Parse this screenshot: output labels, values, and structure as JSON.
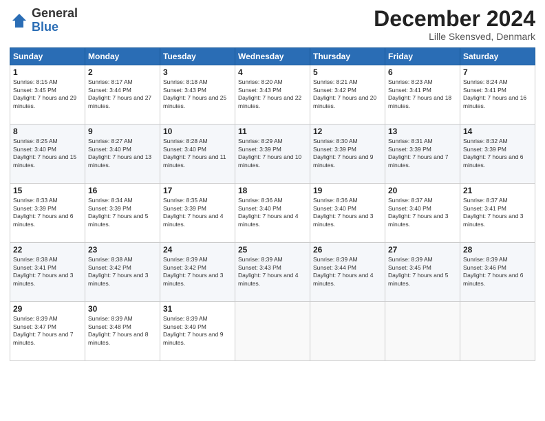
{
  "header": {
    "logo_general": "General",
    "logo_blue": "Blue",
    "month_title": "December 2024",
    "location": "Lille Skensved, Denmark"
  },
  "days_of_week": [
    "Sunday",
    "Monday",
    "Tuesday",
    "Wednesday",
    "Thursday",
    "Friday",
    "Saturday"
  ],
  "weeks": [
    [
      {
        "day": "1",
        "sunrise": "Sunrise: 8:15 AM",
        "sunset": "Sunset: 3:45 PM",
        "daylight": "Daylight: 7 hours and 29 minutes."
      },
      {
        "day": "2",
        "sunrise": "Sunrise: 8:17 AM",
        "sunset": "Sunset: 3:44 PM",
        "daylight": "Daylight: 7 hours and 27 minutes."
      },
      {
        "day": "3",
        "sunrise": "Sunrise: 8:18 AM",
        "sunset": "Sunset: 3:43 PM",
        "daylight": "Daylight: 7 hours and 25 minutes."
      },
      {
        "day": "4",
        "sunrise": "Sunrise: 8:20 AM",
        "sunset": "Sunset: 3:43 PM",
        "daylight": "Daylight: 7 hours and 22 minutes."
      },
      {
        "day": "5",
        "sunrise": "Sunrise: 8:21 AM",
        "sunset": "Sunset: 3:42 PM",
        "daylight": "Daylight: 7 hours and 20 minutes."
      },
      {
        "day": "6",
        "sunrise": "Sunrise: 8:23 AM",
        "sunset": "Sunset: 3:41 PM",
        "daylight": "Daylight: 7 hours and 18 minutes."
      },
      {
        "day": "7",
        "sunrise": "Sunrise: 8:24 AM",
        "sunset": "Sunset: 3:41 PM",
        "daylight": "Daylight: 7 hours and 16 minutes."
      }
    ],
    [
      {
        "day": "8",
        "sunrise": "Sunrise: 8:25 AM",
        "sunset": "Sunset: 3:40 PM",
        "daylight": "Daylight: 7 hours and 15 minutes."
      },
      {
        "day": "9",
        "sunrise": "Sunrise: 8:27 AM",
        "sunset": "Sunset: 3:40 PM",
        "daylight": "Daylight: 7 hours and 13 minutes."
      },
      {
        "day": "10",
        "sunrise": "Sunrise: 8:28 AM",
        "sunset": "Sunset: 3:40 PM",
        "daylight": "Daylight: 7 hours and 11 minutes."
      },
      {
        "day": "11",
        "sunrise": "Sunrise: 8:29 AM",
        "sunset": "Sunset: 3:39 PM",
        "daylight": "Daylight: 7 hours and 10 minutes."
      },
      {
        "day": "12",
        "sunrise": "Sunrise: 8:30 AM",
        "sunset": "Sunset: 3:39 PM",
        "daylight": "Daylight: 7 hours and 9 minutes."
      },
      {
        "day": "13",
        "sunrise": "Sunrise: 8:31 AM",
        "sunset": "Sunset: 3:39 PM",
        "daylight": "Daylight: 7 hours and 7 minutes."
      },
      {
        "day": "14",
        "sunrise": "Sunrise: 8:32 AM",
        "sunset": "Sunset: 3:39 PM",
        "daylight": "Daylight: 7 hours and 6 minutes."
      }
    ],
    [
      {
        "day": "15",
        "sunrise": "Sunrise: 8:33 AM",
        "sunset": "Sunset: 3:39 PM",
        "daylight": "Daylight: 7 hours and 6 minutes."
      },
      {
        "day": "16",
        "sunrise": "Sunrise: 8:34 AM",
        "sunset": "Sunset: 3:39 PM",
        "daylight": "Daylight: 7 hours and 5 minutes."
      },
      {
        "day": "17",
        "sunrise": "Sunrise: 8:35 AM",
        "sunset": "Sunset: 3:39 PM",
        "daylight": "Daylight: 7 hours and 4 minutes."
      },
      {
        "day": "18",
        "sunrise": "Sunrise: 8:36 AM",
        "sunset": "Sunset: 3:40 PM",
        "daylight": "Daylight: 7 hours and 4 minutes."
      },
      {
        "day": "19",
        "sunrise": "Sunrise: 8:36 AM",
        "sunset": "Sunset: 3:40 PM",
        "daylight": "Daylight: 7 hours and 3 minutes."
      },
      {
        "day": "20",
        "sunrise": "Sunrise: 8:37 AM",
        "sunset": "Sunset: 3:40 PM",
        "daylight": "Daylight: 7 hours and 3 minutes."
      },
      {
        "day": "21",
        "sunrise": "Sunrise: 8:37 AM",
        "sunset": "Sunset: 3:41 PM",
        "daylight": "Daylight: 7 hours and 3 minutes."
      }
    ],
    [
      {
        "day": "22",
        "sunrise": "Sunrise: 8:38 AM",
        "sunset": "Sunset: 3:41 PM",
        "daylight": "Daylight: 7 hours and 3 minutes."
      },
      {
        "day": "23",
        "sunrise": "Sunrise: 8:38 AM",
        "sunset": "Sunset: 3:42 PM",
        "daylight": "Daylight: 7 hours and 3 minutes."
      },
      {
        "day": "24",
        "sunrise": "Sunrise: 8:39 AM",
        "sunset": "Sunset: 3:42 PM",
        "daylight": "Daylight: 7 hours and 3 minutes."
      },
      {
        "day": "25",
        "sunrise": "Sunrise: 8:39 AM",
        "sunset": "Sunset: 3:43 PM",
        "daylight": "Daylight: 7 hours and 4 minutes."
      },
      {
        "day": "26",
        "sunrise": "Sunrise: 8:39 AM",
        "sunset": "Sunset: 3:44 PM",
        "daylight": "Daylight: 7 hours and 4 minutes."
      },
      {
        "day": "27",
        "sunrise": "Sunrise: 8:39 AM",
        "sunset": "Sunset: 3:45 PM",
        "daylight": "Daylight: 7 hours and 5 minutes."
      },
      {
        "day": "28",
        "sunrise": "Sunrise: 8:39 AM",
        "sunset": "Sunset: 3:46 PM",
        "daylight": "Daylight: 7 hours and 6 minutes."
      }
    ],
    [
      {
        "day": "29",
        "sunrise": "Sunrise: 8:39 AM",
        "sunset": "Sunset: 3:47 PM",
        "daylight": "Daylight: 7 hours and 7 minutes."
      },
      {
        "day": "30",
        "sunrise": "Sunrise: 8:39 AM",
        "sunset": "Sunset: 3:48 PM",
        "daylight": "Daylight: 7 hours and 8 minutes."
      },
      {
        "day": "31",
        "sunrise": "Sunrise: 8:39 AM",
        "sunset": "Sunset: 3:49 PM",
        "daylight": "Daylight: 7 hours and 9 minutes."
      },
      null,
      null,
      null,
      null
    ]
  ]
}
